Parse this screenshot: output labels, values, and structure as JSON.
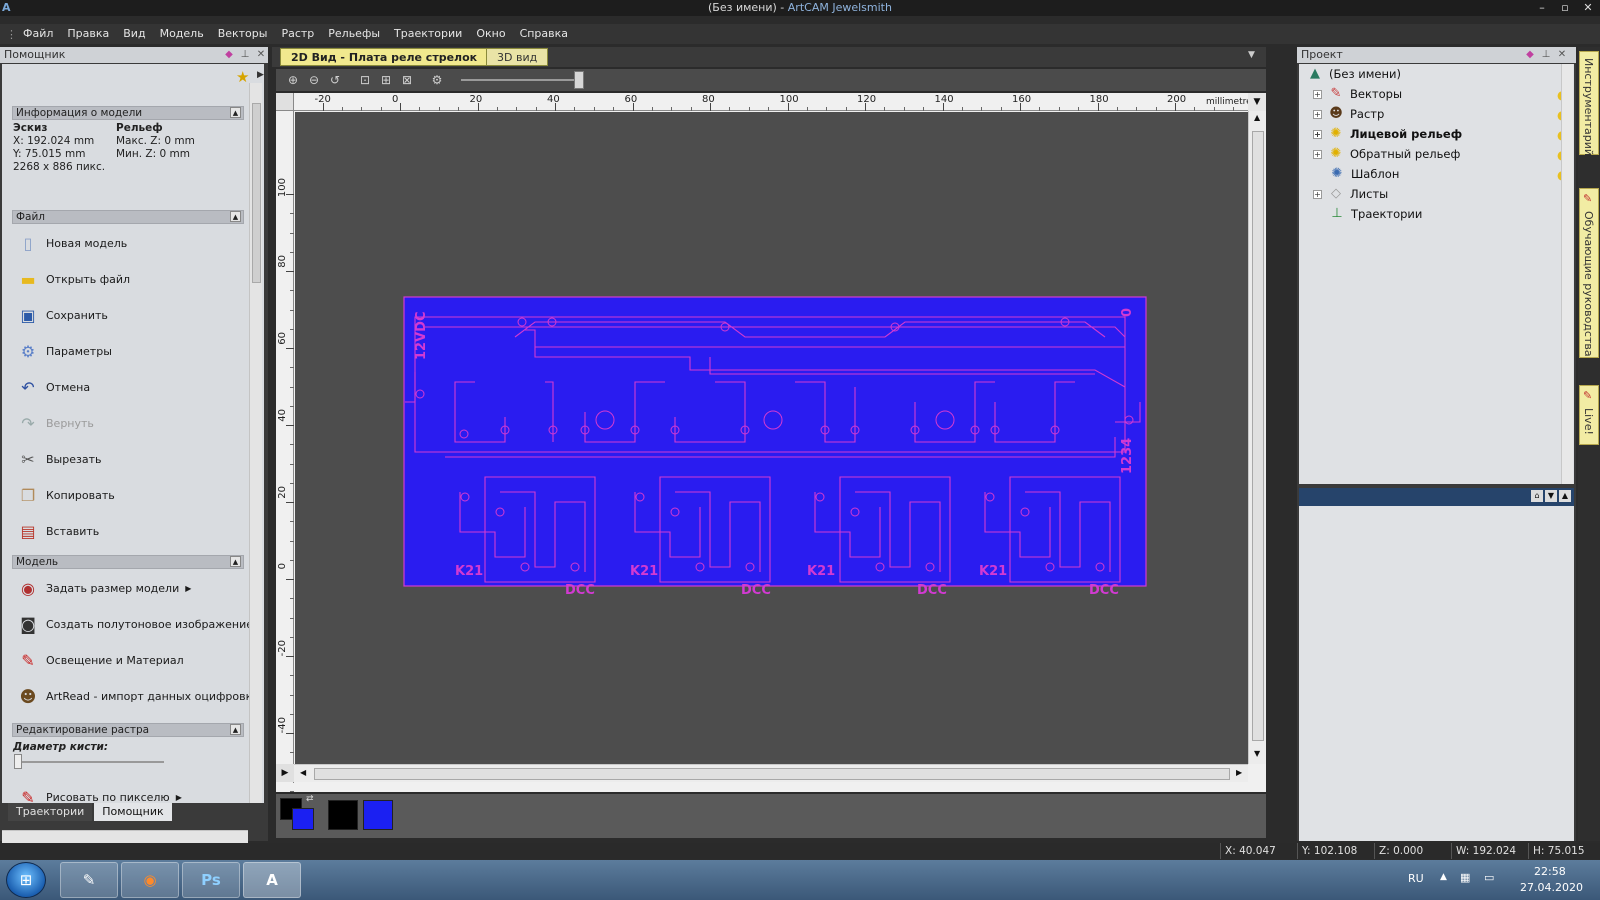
{
  "window": {
    "title_prefix": "(Без имени) - ",
    "title_app": "ArtCAM Jewelsmith",
    "controls": [
      "–",
      "▫",
      "✕"
    ]
  },
  "menu": [
    "Файл",
    "Правка",
    "Вид",
    "Модель",
    "Векторы",
    "Растр",
    "Рельефы",
    "Траектории",
    "Окно",
    "Справка"
  ],
  "left_panel": {
    "title": "Помощник",
    "info_section": {
      "header": "Информация о модели",
      "sketch_label": "Эскиз",
      "relief_label": "Рельеф",
      "x": "X: 192.024 mm",
      "y": "Y: 75.015 mm",
      "pixels": "2268 x 886 пикс.",
      "max_z": "Макс. Z: 0 mm",
      "min_z": "Мин. Z: 0 mm"
    },
    "file_section": {
      "header": "Файл",
      "items": [
        {
          "label": "Новая модель",
          "icon": "new-file-icon"
        },
        {
          "label": "Открыть файл",
          "icon": "open-folder-icon"
        },
        {
          "label": "Сохранить",
          "icon": "save-icon"
        },
        {
          "label": "Параметры",
          "icon": "settings-icon"
        },
        {
          "label": "Отмена",
          "icon": "undo-icon"
        },
        {
          "label": "Вернуть",
          "icon": "redo-icon"
        },
        {
          "label": "Вырезать",
          "icon": "scissors-icon"
        },
        {
          "label": "Копировать",
          "icon": "copy-icon"
        },
        {
          "label": "Вставить",
          "icon": "paste-icon"
        }
      ]
    },
    "model_section": {
      "header": "Модель",
      "items": [
        {
          "label": "Задать размер модели",
          "icon": "model-size-icon"
        },
        {
          "label": "Создать полутоновое изображение",
          "icon": "grayscale-icon"
        },
        {
          "label": "Освещение и Материал",
          "icon": "lighting-icon"
        },
        {
          "label": "ArtRead - импорт данных оцифровки",
          "icon": "artread-icon"
        }
      ]
    },
    "raster_section": {
      "header": "Редактирование растра",
      "brush_label": "Диаметр кисти:",
      "paint_label": "Рисовать по пикселю"
    },
    "bottom_tabs": [
      "Траектории",
      "Помощник"
    ]
  },
  "document": {
    "tabs": [
      "2D Вид - Плата реле стрелок",
      "3D вид"
    ],
    "ruler_unit": "millimetres",
    "h_ticks": [
      "-20",
      "0",
      "20",
      "40",
      "60",
      "80",
      "100",
      "120",
      "140",
      "160",
      "180",
      "200"
    ],
    "v_ticks": [
      "100",
      "80",
      "60",
      "40",
      "20",
      "0",
      "-20",
      "-40"
    ],
    "pcb_labels": {
      "left_top": "12VDC",
      "right_top": "0",
      "right_mid": "1234",
      "relays": [
        "K21",
        "K21",
        "K21",
        "K21"
      ],
      "dcc": [
        "DCC",
        "DCC",
        "DCC",
        "DCC"
      ]
    },
    "colors": {
      "board": "#2a1cf0",
      "trace": "#d23ad2",
      "primary": "#000000",
      "secondary": "#1b20f2"
    }
  },
  "right_panel": {
    "title": "Проект",
    "tree": [
      {
        "label": "(Без имени)",
        "icon": "project-icon",
        "bold": false
      },
      {
        "label": "Векторы",
        "icon": "vectors-icon",
        "bold": false
      },
      {
        "label": "Растр",
        "icon": "raster-icon",
        "bold": false
      },
      {
        "label": "Лицевой рельеф",
        "icon": "front-relief-icon",
        "bold": true
      },
      {
        "label": "Обратный рельеф",
        "icon": "back-relief-icon",
        "bold": false
      },
      {
        "label": "Шаблон",
        "icon": "template-icon",
        "bold": false
      },
      {
        "label": "Листы",
        "icon": "sheets-icon",
        "bold": false
      },
      {
        "label": "Траектории",
        "icon": "toolpaths-icon",
        "bold": false
      }
    ]
  },
  "side_tabs": [
    "Инструментарий",
    "Обучающие руководства",
    "Live!"
  ],
  "status": {
    "x": "X: 40.047",
    "y": "Y: 102.108",
    "z": "Z: 0.000",
    "w": "W: 192.024",
    "h": "H: 75.015"
  },
  "taskbar": {
    "lang": "RU",
    "time": "22:58",
    "date": "27.04.2020",
    "apps": [
      "notepad-icon",
      "firefox-icon",
      "photoshop-icon",
      "artcam-icon"
    ],
    "ps_label": "Ps"
  }
}
